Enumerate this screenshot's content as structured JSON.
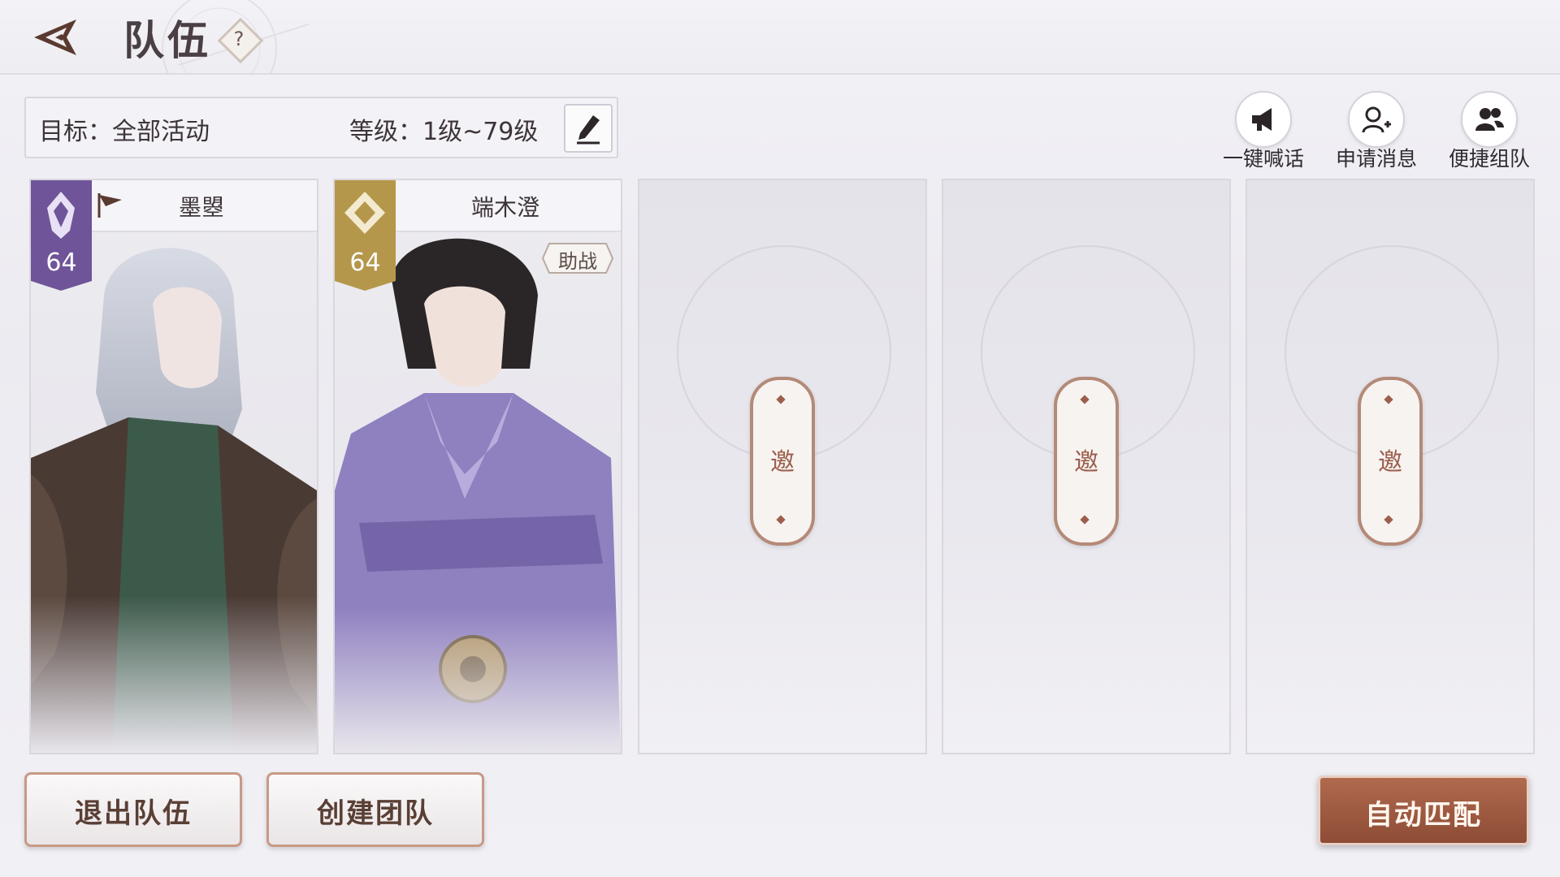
{
  "header": {
    "title": "队伍",
    "help_label": "?"
  },
  "filter": {
    "target_label": "目标：全部活动",
    "level_label": "等级：1级~79级"
  },
  "quick_actions": [
    {
      "label": "一键喊话",
      "icon": "megaphone-icon"
    },
    {
      "label": "申请消息",
      "icon": "add-user-icon"
    },
    {
      "label": "便捷组队",
      "icon": "group-icon"
    }
  ],
  "members": [
    {
      "name": "墨曌",
      "level": "64",
      "badge_color": "#7b5ea8",
      "leader": true,
      "tag": ""
    },
    {
      "name": "端木澄",
      "level": "64",
      "badge_color": "#b89a4a",
      "leader": false,
      "tag": "助战"
    }
  ],
  "empty_slots": [
    {
      "invite_label": "邀"
    },
    {
      "invite_label": "邀"
    },
    {
      "invite_label": "邀"
    }
  ],
  "buttons": {
    "leave": "退出队伍",
    "create": "创建团队",
    "auto_match": "自动匹配"
  },
  "colors": {
    "accent": "#9c5f4b",
    "primary_button": "#a05c43",
    "purple_badge": "#7b5ea8",
    "gold_badge": "#b89a4a"
  }
}
